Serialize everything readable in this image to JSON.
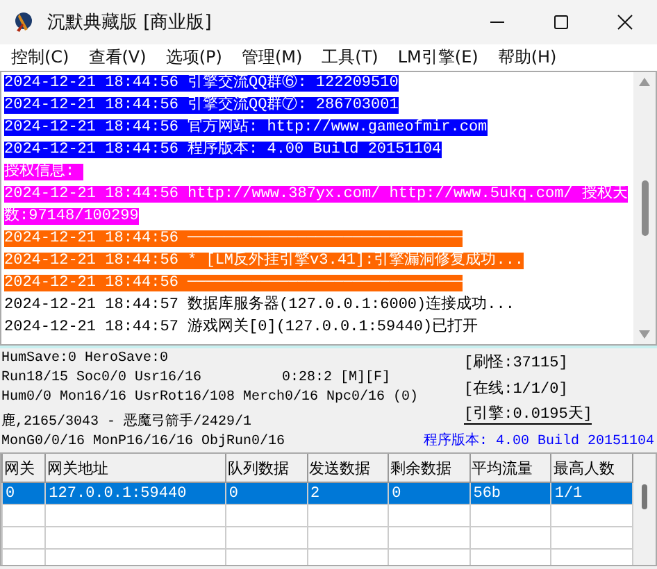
{
  "window": {
    "title": "沉默典藏版 [商业版]"
  },
  "menu": [
    "控制(C)",
    "查看(V)",
    "选项(P)",
    "管理(M)",
    "工具(T)",
    "LM引擎(E)",
    "帮助(H)"
  ],
  "log": [
    {
      "kind": "blue",
      "text": "2024-12-21 18:44:56 引擎交流QQ群⑥: 122209510"
    },
    {
      "kind": "blue",
      "text": "2024-12-21 18:44:56 引擎交流QQ群⑦: 286703001"
    },
    {
      "kind": "blue",
      "text": "2024-12-21 18:44:56 官方网站: http://www.gameofmir.com"
    },
    {
      "kind": "blue",
      "text": "2024-12-21 18:44:56 程序版本: 4.00 Build 20151104"
    },
    {
      "kind": "magenta",
      "text": "授权信息: "
    },
    {
      "kind": "magenta",
      "text": "2024-12-21 18:44:56 http://www.387yx.com/ http://www.5ukq.com/ 授权天"
    },
    {
      "kind": "magenta",
      "text": "数:97148/100299"
    },
    {
      "kind": "orange",
      "text": "2024-12-21 18:44:56 ──────────────────────────────"
    },
    {
      "kind": "orange",
      "text": "2024-12-21 18:44:56 * [LM反外挂引擎v3.41]:引擎漏洞修复成功..."
    },
    {
      "kind": "orange",
      "text": "2024-12-21 18:44:56 ──────────────────────────────"
    },
    {
      "kind": "plain",
      "text": "2024-12-21 18:44:57 数据库服务器(127.0.0.1:6000)连接成功..."
    },
    {
      "kind": "plain",
      "text": "2024-12-21 18:44:57 游戏网关[0](127.0.0.1:59440)已打开"
    }
  ],
  "status": {
    "lines": [
      "HumSave:0 HeroSave:0",
      "Run18/15 Soc0/0 Usr16/16",
      "Hum0/0 Mon16/16 UsrRot16/108 Merch0/16 Npc0/16 (0)",
      "鹿,2165/3043 - 恶魔弓箭手/2429/1",
      "MonG0/0/16 MonP16/16/16 ObjRun0/16"
    ],
    "timer": "0:28:2 [M][F]",
    "counters": [
      "[刷怪:37115]",
      "[在线:1/1/0]",
      "[引擎:0.0195天]"
    ],
    "version": "程序版本: 4.00 Build 20151104"
  },
  "table": {
    "columns": [
      "网关",
      "网关地址",
      "队列数据",
      "发送数据",
      "剩余数据",
      "平均流量",
      "最高人数"
    ],
    "rows": [
      {
        "selected": true,
        "cells": [
          "0",
          "127.0.0.1:59440",
          "0",
          "2",
          "0",
          "56b",
          "1/1"
        ]
      }
    ]
  }
}
